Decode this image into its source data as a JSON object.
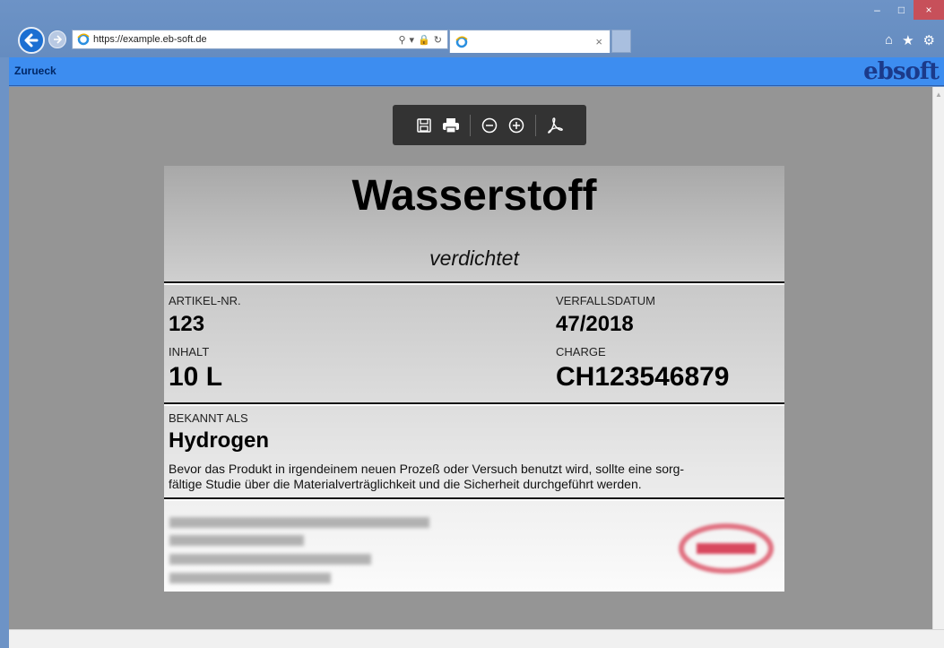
{
  "browser": {
    "url": "https://example.eb-soft.de",
    "tab_title": "",
    "tab_close": "×",
    "window_controls": {
      "minimize": "–",
      "maximize": "□",
      "close": "×"
    },
    "toolbar_icons": [
      "home-icon",
      "star-icon",
      "gear-icon"
    ]
  },
  "app": {
    "back_label": "Zurueck",
    "logo_text": "ebsoft"
  },
  "viewer": {
    "toolbar_buttons": [
      "save-icon",
      "print-icon",
      "zoom-out-icon",
      "zoom-in-icon",
      "acrobat-icon"
    ]
  },
  "label": {
    "title": "Wasserstoff",
    "subtitle": "verdichtet",
    "article_label": "ARTIKEL-NR.",
    "article_value": "123",
    "expiry_label": "VERFALLSDATUM",
    "expiry_value": "47/2018",
    "content_label": "INHALT",
    "content_value": "10 L",
    "batch_label": "CHARGE",
    "batch_value": "CH123546879",
    "known_as_label": "BEKANNT ALS",
    "known_as_value": "Hydrogen",
    "description_line1": "Bevor das Produkt in irgendeinem neuen Prozeß oder Versuch benutzt wird, sollte eine sorg-",
    "description_line2": "fältige Studie über die Materialverträglichkeit und die Sicherheit durchgeführt werden."
  },
  "colors": {
    "app_bar": "#3d8df0",
    "viewer_bg": "#959595",
    "stamp": "#e07080"
  }
}
